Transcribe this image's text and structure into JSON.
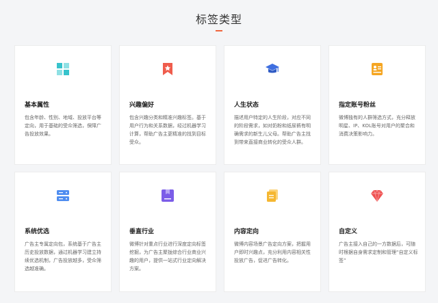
{
  "page": {
    "title": "标签类型"
  },
  "cards": [
    {
      "title": "基本属性",
      "desc": "包含年龄、性别、地域、投放平台等定向，用于基础的受众筛选，保障广告投放效果。",
      "icon": "grid-blocks-icon",
      "icon_color": "#37c3cc"
    },
    {
      "title": "兴趣偏好",
      "desc": "包含兴趣分类和精准兴趣标签。基于用户行为和关系数据，经过机器学习计算，帮助广告主更精准的找到目标受众。",
      "icon": "bookmark-star-icon",
      "icon_color": "#ef5c4c"
    },
    {
      "title": "人生状态",
      "desc": "描述用户特定的人生阶段，对应不同的阶段需求，如对奶粉和纸尿裤有明确需求的新生儿父母。帮助广告主找到带来直接商业转化的受众人群。",
      "icon": "graduation-cap-icon",
      "icon_color": "#3f6fe0"
    },
    {
      "title": "指定账号粉丝",
      "desc": "微博独有的人群筛选方式，充分释放明星、IP、KOL账号对用户的聚合和消费决策影响力。",
      "icon": "contact-card-icon",
      "icon_color": "#f5a623"
    },
    {
      "title": "系统优选",
      "desc": "广告主专属定向包，系统基于广告主历史投放数据，通过机器学习建立持续优选机制，广告投放越多，受众筛选越准确。",
      "icon": "server-icon",
      "icon_color": "#4f8df0"
    },
    {
      "title": "垂直行业",
      "desc": "微博针对重点行业进行深度定向标签挖掘，为广告主聚拢综合行业商业兴趣的用户，提供一站式行业定向解决方案。",
      "icon": "folder-box-icon",
      "icon_color": "#7b5de8"
    },
    {
      "title": "内容定向",
      "desc": "微博内容场景广告定向方案，把握用户即时兴趣点，充分利用内容相关性投放广告，促进广告转化。",
      "icon": "document-stack-icon",
      "icon_color": "#f5b731"
    },
    {
      "title": "自定义",
      "desc": "广告主接入自己的一方数据后，可随时根据自身需求定制和管理“自定义标签”",
      "icon": "gem-icon",
      "icon_color": "#ef5050"
    }
  ]
}
